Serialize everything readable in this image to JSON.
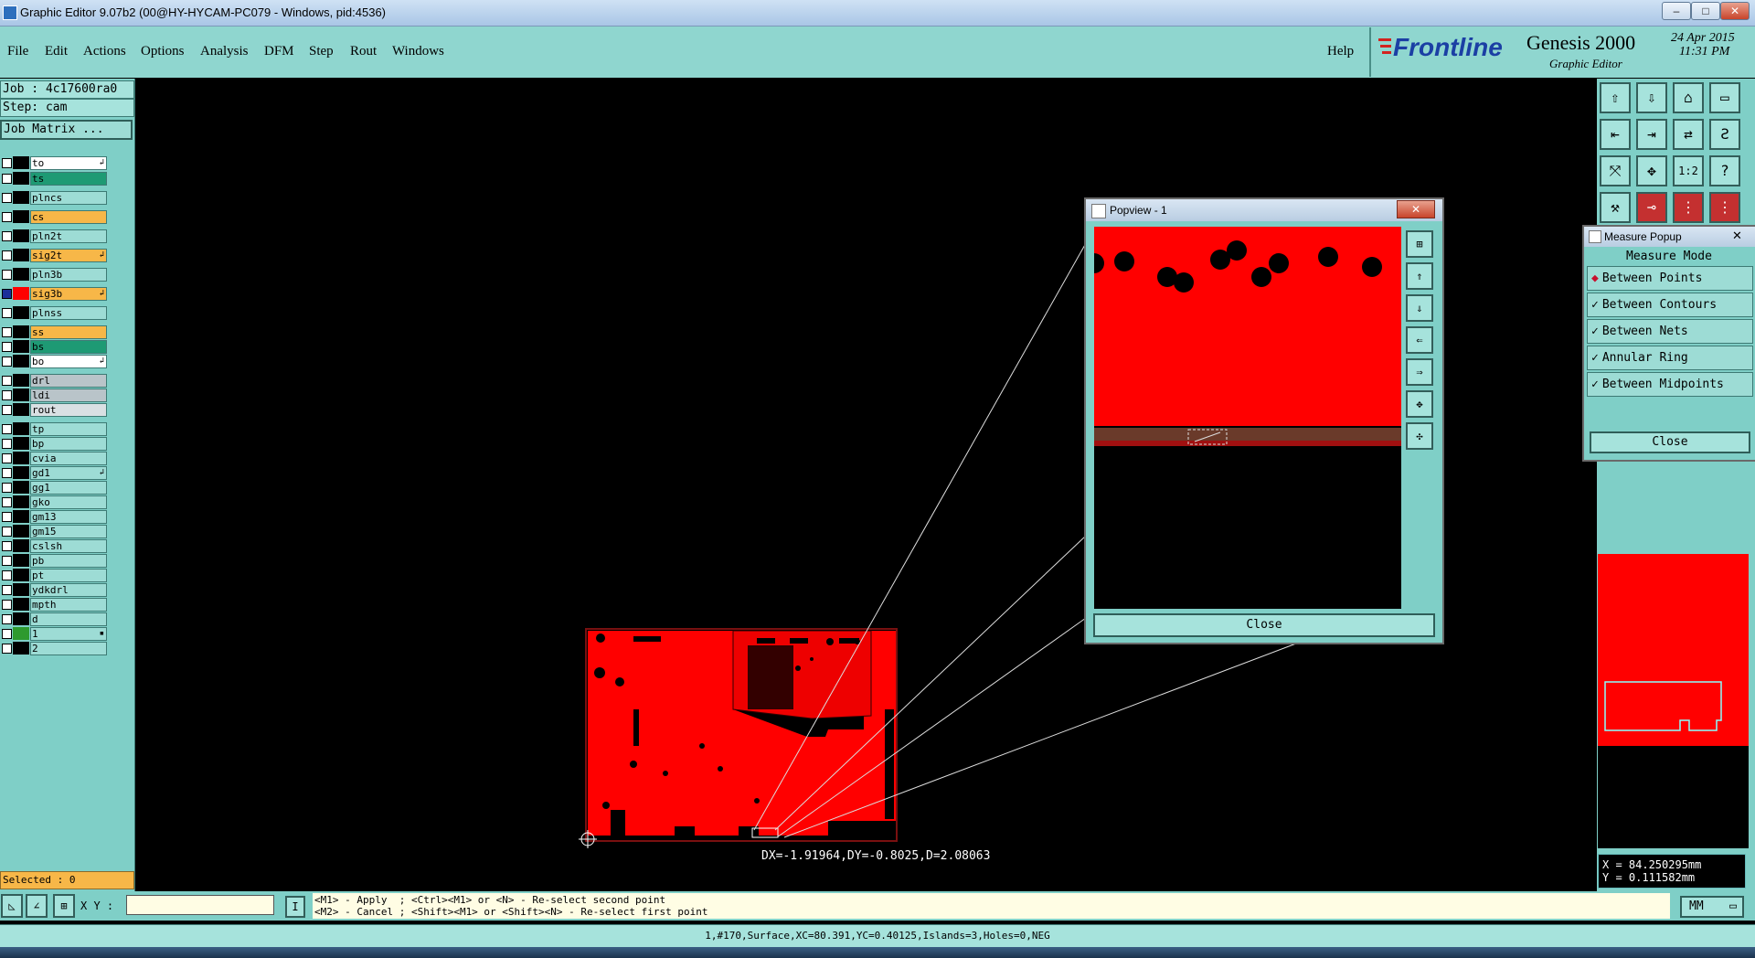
{
  "window": {
    "title": "Graphic Editor 9.07b2 (00@HY-HYCAM-PC079 - Windows, pid:4536)",
    "minimize": "–",
    "maximize": "□",
    "close": "✕"
  },
  "menu": {
    "items": [
      "File",
      "Edit",
      "Actions",
      "Options",
      "Analysis",
      "DFM",
      "Step",
      "Rout",
      "Windows"
    ],
    "help": "Help"
  },
  "brand": {
    "logo": "Frontline",
    "product": "Genesis 2000",
    "subtitle": "Graphic Editor",
    "date": "24 Apr 2015",
    "time": "11:31 PM"
  },
  "job": {
    "job": "Job : 4c17600ra0",
    "step": "Step: cam",
    "matrix": "Job Matrix ..."
  },
  "layers": [
    {
      "name": "to",
      "color": "#ffffff",
      "active": false,
      "mark": "↲",
      "sw": "#000000"
    },
    {
      "name": "ts",
      "color": "#1e9a74",
      "active": false,
      "mark": "",
      "sw": "#000000"
    },
    {
      "name": "plncs",
      "color": "#9ddcd5",
      "active": false,
      "mark": "",
      "sw": "#000000"
    },
    {
      "name": "cs",
      "color": "#f7b748",
      "active": false,
      "mark": "",
      "sw": "#000000"
    },
    {
      "name": "pln2t",
      "color": "#9ddcd5",
      "active": false,
      "mark": "",
      "sw": "#000000"
    },
    {
      "name": "sig2t",
      "color": "#f7b748",
      "active": false,
      "mark": "↲",
      "sw": "#000000"
    },
    {
      "name": "pln3b",
      "color": "#9ddcd5",
      "active": false,
      "mark": "",
      "sw": "#000000"
    },
    {
      "name": "sig3b",
      "color": "#f7b748",
      "active": true,
      "mark": "↲",
      "sw": "#ff0000"
    },
    {
      "name": "plnss",
      "color": "#9ddcd5",
      "active": false,
      "mark": "",
      "sw": "#000000"
    },
    {
      "name": "ss",
      "color": "#f7b748",
      "active": false,
      "mark": "",
      "sw": "#000000"
    },
    {
      "name": "bs",
      "color": "#1e9a74",
      "active": false,
      "mark": "",
      "sw": "#000000"
    },
    {
      "name": "bo",
      "color": "#ffffff",
      "active": false,
      "mark": "↲",
      "sw": "#000000"
    },
    {
      "name": "drl",
      "color": "#b9c4c9",
      "active": false,
      "mark": "",
      "sw": "#000000"
    },
    {
      "name": "ldi",
      "color": "#b9c4c9",
      "active": false,
      "mark": "",
      "sw": "#000000"
    },
    {
      "name": "rout",
      "color": "#d9e0e3",
      "active": false,
      "mark": "",
      "sw": "#000000"
    },
    {
      "name": "tp",
      "color": "#9ddcd5",
      "active": false,
      "mark": "",
      "sw": "#000000"
    },
    {
      "name": "bp",
      "color": "#9ddcd5",
      "active": false,
      "mark": "",
      "sw": "#000000"
    },
    {
      "name": "cvia",
      "color": "#9ddcd5",
      "active": false,
      "mark": "",
      "sw": "#000000"
    },
    {
      "name": "gd1",
      "color": "#9ddcd5",
      "active": false,
      "mark": "↲",
      "sw": "#000000"
    },
    {
      "name": "gg1",
      "color": "#9ddcd5",
      "active": false,
      "mark": "",
      "sw": "#000000"
    },
    {
      "name": "gko",
      "color": "#9ddcd5",
      "active": false,
      "mark": "",
      "sw": "#000000"
    },
    {
      "name": "gm13",
      "color": "#9ddcd5",
      "active": false,
      "mark": "",
      "sw": "#000000"
    },
    {
      "name": "gm15",
      "color": "#9ddcd5",
      "active": false,
      "mark": "",
      "sw": "#000000"
    },
    {
      "name": "cslsh",
      "color": "#9ddcd5",
      "active": false,
      "mark": "",
      "sw": "#000000"
    },
    {
      "name": "pb",
      "color": "#9ddcd5",
      "active": false,
      "mark": "",
      "sw": "#000000"
    },
    {
      "name": "pt",
      "color": "#9ddcd5",
      "active": false,
      "mark": "",
      "sw": "#000000"
    },
    {
      "name": "ydkdrl",
      "color": "#9ddcd5",
      "active": false,
      "mark": "",
      "sw": "#000000"
    },
    {
      "name": "mpth",
      "color": "#9ddcd5",
      "active": false,
      "mark": "",
      "sw": "#000000"
    },
    {
      "name": "d",
      "color": "#9ddcd5",
      "active": false,
      "mark": "",
      "sw": "#000000"
    },
    {
      "name": "1",
      "color": "#9ddcd5",
      "active": false,
      "mark": "▪",
      "sw": "#2e9a2e"
    },
    {
      "name": "2",
      "color": "#9ddcd5",
      "active": false,
      "mark": "",
      "sw": "#000000"
    }
  ],
  "selected": "Selected : 0",
  "canvas": {
    "measure_readout": "DX=-1.91964,DY=-0.8025,D=2.08063"
  },
  "popview": {
    "title": "Popview - 1",
    "close_label": "Close"
  },
  "measure_popup": {
    "title": "Measure Popup",
    "mode_label": "Measure Mode",
    "options": [
      {
        "label": "Between Points",
        "selected": true
      },
      {
        "label": "Between Contours",
        "selected": false
      },
      {
        "label": "Between Nets",
        "selected": false
      },
      {
        "label": "Annular Ring",
        "selected": false
      },
      {
        "label": "Between Midpoints",
        "selected": false
      }
    ],
    "close_label": "Close"
  },
  "toolbar_icons": [
    "home-icon",
    "save-icon",
    "house-icon",
    "window-icon",
    "zoom-left-icon",
    "zoom-right-icon",
    "pan-icon",
    "route-icon",
    "fit-icon",
    "center-icon",
    "ratio-icon",
    "help-icon",
    "tools-icon",
    "line-icon",
    "board-icon",
    "board2-icon"
  ],
  "ratio_label": "1:2",
  "help_glyph": "?",
  "coordinates": {
    "x": "X = 84.250295mm",
    "y": "Y = 0.111582mm"
  },
  "xy_label": "X Y :",
  "xy_value": "",
  "prompt": {
    "line1": "<M1> - Apply  ; <Ctrl><M1> or <N> - Re-select second point",
    "line2": "<M2> - Cancel ; <Shift><M1> or <Shift><N> - Re-select first point"
  },
  "units": "MM",
  "status": "1,#170,Surface,XC=80.391,YC=0.40125,Islands=3,Holes=0,NEG"
}
